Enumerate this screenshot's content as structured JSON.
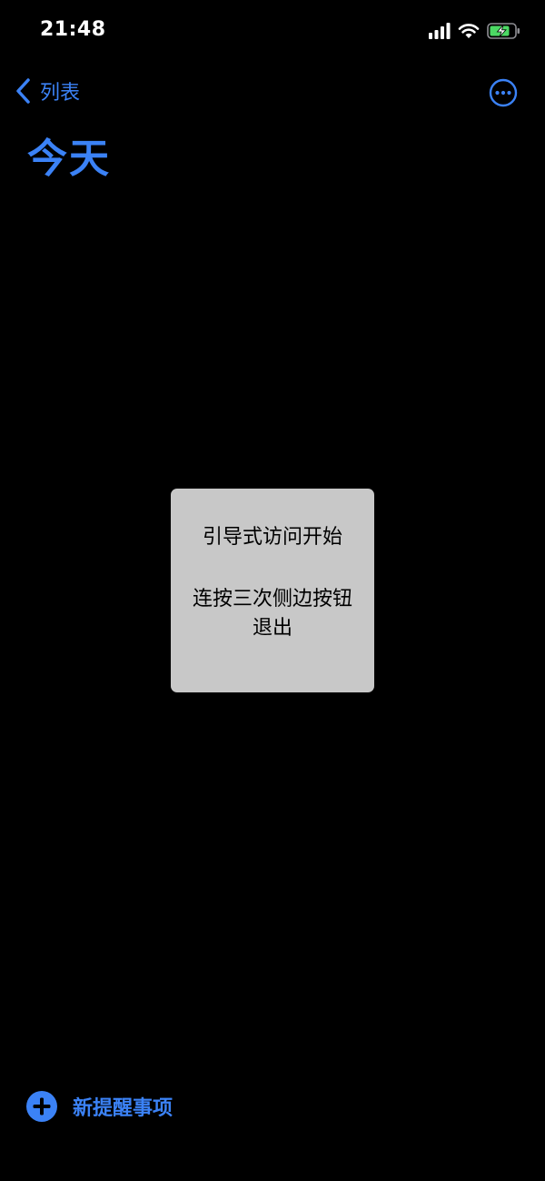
{
  "status_bar": {
    "time": "21:48",
    "icons": [
      "cellular-signal-icon",
      "wifi-icon",
      "battery-charging-icon"
    ]
  },
  "nav": {
    "back_label": "列表",
    "more_icon": "ellipsis-circle-icon"
  },
  "page": {
    "title": "今天"
  },
  "hud": {
    "title": "引导式访问开始",
    "message": "连按三次侧边按钮退出"
  },
  "toolbar": {
    "add_label": "新提醒事项",
    "add_icon": "plus-circle-icon"
  },
  "colors": {
    "accent": "#3b82f6",
    "background": "#000000",
    "hud_background": "#c8c8c8",
    "battery_fill": "#4cd964"
  }
}
